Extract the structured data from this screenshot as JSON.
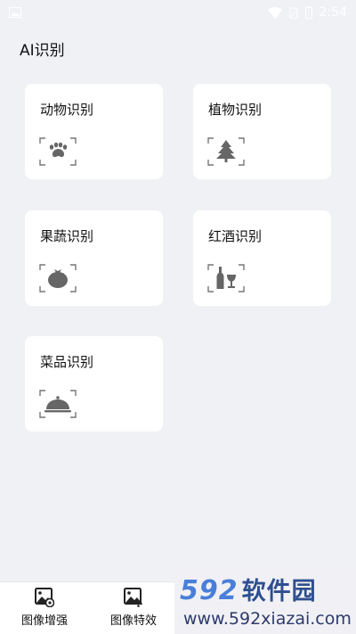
{
  "statusbar": {
    "time": "2:54"
  },
  "page": {
    "title": "AI识别"
  },
  "cards": [
    {
      "label": "动物识别",
      "icon": "paw-icon"
    },
    {
      "label": "植物识别",
      "icon": "tree-icon"
    },
    {
      "label": "果蔬识别",
      "icon": "tomato-icon"
    },
    {
      "label": "红酒识别",
      "icon": "wine-icon"
    },
    {
      "label": "菜品识别",
      "icon": "dish-cloche-icon"
    }
  ],
  "bottom_nav": [
    {
      "label": "图像增强",
      "icon": "image-enhance-icon"
    },
    {
      "label": "图像特效",
      "icon": "image-effect-icon"
    }
  ],
  "watermark": {
    "logo_num": "592",
    "logo_cn": "软件园",
    "url": "www.592xiazai.com"
  },
  "colors": {
    "background": "#f0f1f5",
    "card": "#ffffff",
    "icon": "#666666",
    "watermark_blue": "#4a7fd9"
  }
}
